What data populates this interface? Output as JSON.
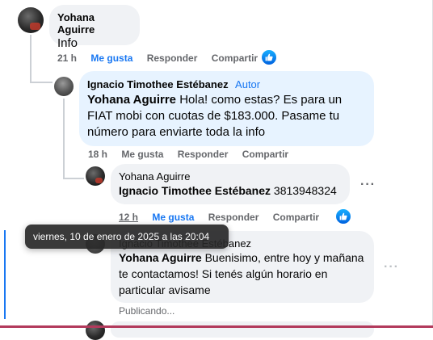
{
  "comments": [
    {
      "author": "Yohana Aguirre",
      "text": "Info",
      "time": "21 h",
      "like": "Me gusta",
      "reply": "Responder",
      "share": "Compartir"
    },
    {
      "author": "Ignacio Timothee Estébanez",
      "author_tag": "Autor",
      "mention": "Yohana Aguirre",
      "text": "Hola! como estas? Es para un FIAT mobi con cuotas de $183.000. Pasame tu número para enviarte toda la info",
      "time": "18 h",
      "like": "Me gusta",
      "reply": "Responder",
      "share": "Compartir"
    },
    {
      "author": "Yohana Aguirre",
      "mention": "Ignacio Timothee Estébanez",
      "text": "3813948324",
      "time": "12 h",
      "like": "Me gusta",
      "reply": "Responder",
      "share": "Compartir"
    },
    {
      "author": "Ignacio Timothee Estébanez",
      "mention": "Yohana Aguirre",
      "text": "Buenisimo, entre hoy y mañana te contactamos! Si tenés algún horario en particular avisame",
      "status": "Publicando..."
    }
  ],
  "tooltip": "viernes, 10 de enero de 2025 a las 20:04",
  "icons": {
    "like_badge": "thumbs-up-icon",
    "more": "more-options-icon"
  },
  "colors": {
    "link_blue": "#1877f2",
    "bubble_gray": "#f0f2f5",
    "author_bubble": "#e7f3ff",
    "meta_gray": "#65676b"
  }
}
